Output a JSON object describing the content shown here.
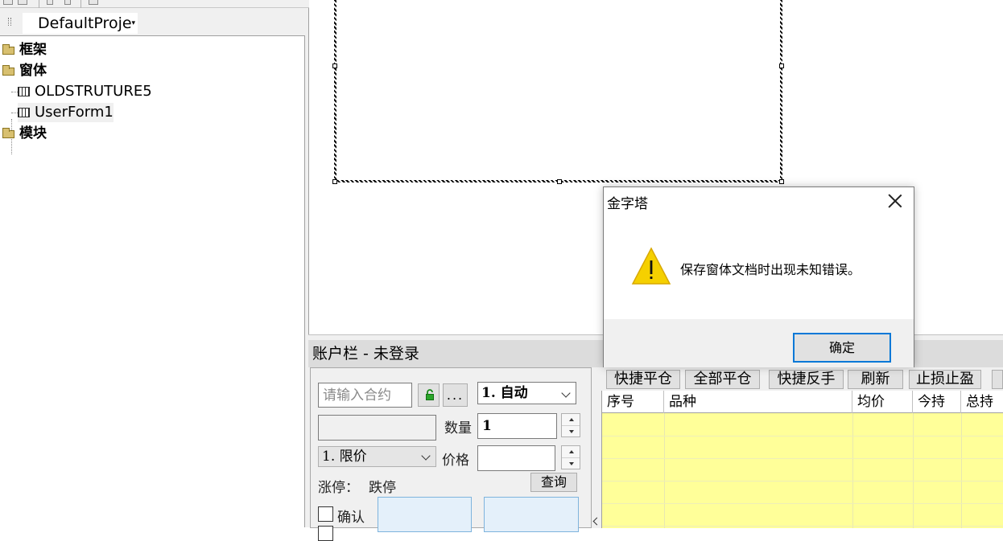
{
  "explorer": {
    "project_combo": "DefaultProje",
    "tree": [
      {
        "label": "框架",
        "kind": "folder"
      },
      {
        "label": "窗体",
        "kind": "folder"
      },
      {
        "label": "OLDSTRUTURE5",
        "kind": "form"
      },
      {
        "label": "UserForm1",
        "kind": "form"
      },
      {
        "label": "模块",
        "kind": "folder"
      }
    ]
  },
  "account": {
    "title": "账户栏  -  未登录",
    "contract_placeholder": "请输入合约",
    "more_label": "...",
    "mode_combo": "1. 自动",
    "qty_label": "数量",
    "qty_value": "1",
    "order_type_combo": "1. 限价",
    "price_label": "价格",
    "price_value": "",
    "limit_up_label": "涨停：",
    "limit_down_label": "跌停",
    "query_label": "查询",
    "confirm_label": "确认",
    "toolbar": [
      "快捷平仓",
      "全部平仓",
      "快捷反手",
      "刷新",
      "止损止盈"
    ],
    "grid_headers": [
      "序号",
      "品种",
      "均价",
      "今持",
      "总持"
    ]
  },
  "dialog": {
    "title": "金字塔",
    "message": "保存窗体文档时出现未知错误。",
    "ok_label": "确定",
    "warning_color": "#f5d000"
  }
}
